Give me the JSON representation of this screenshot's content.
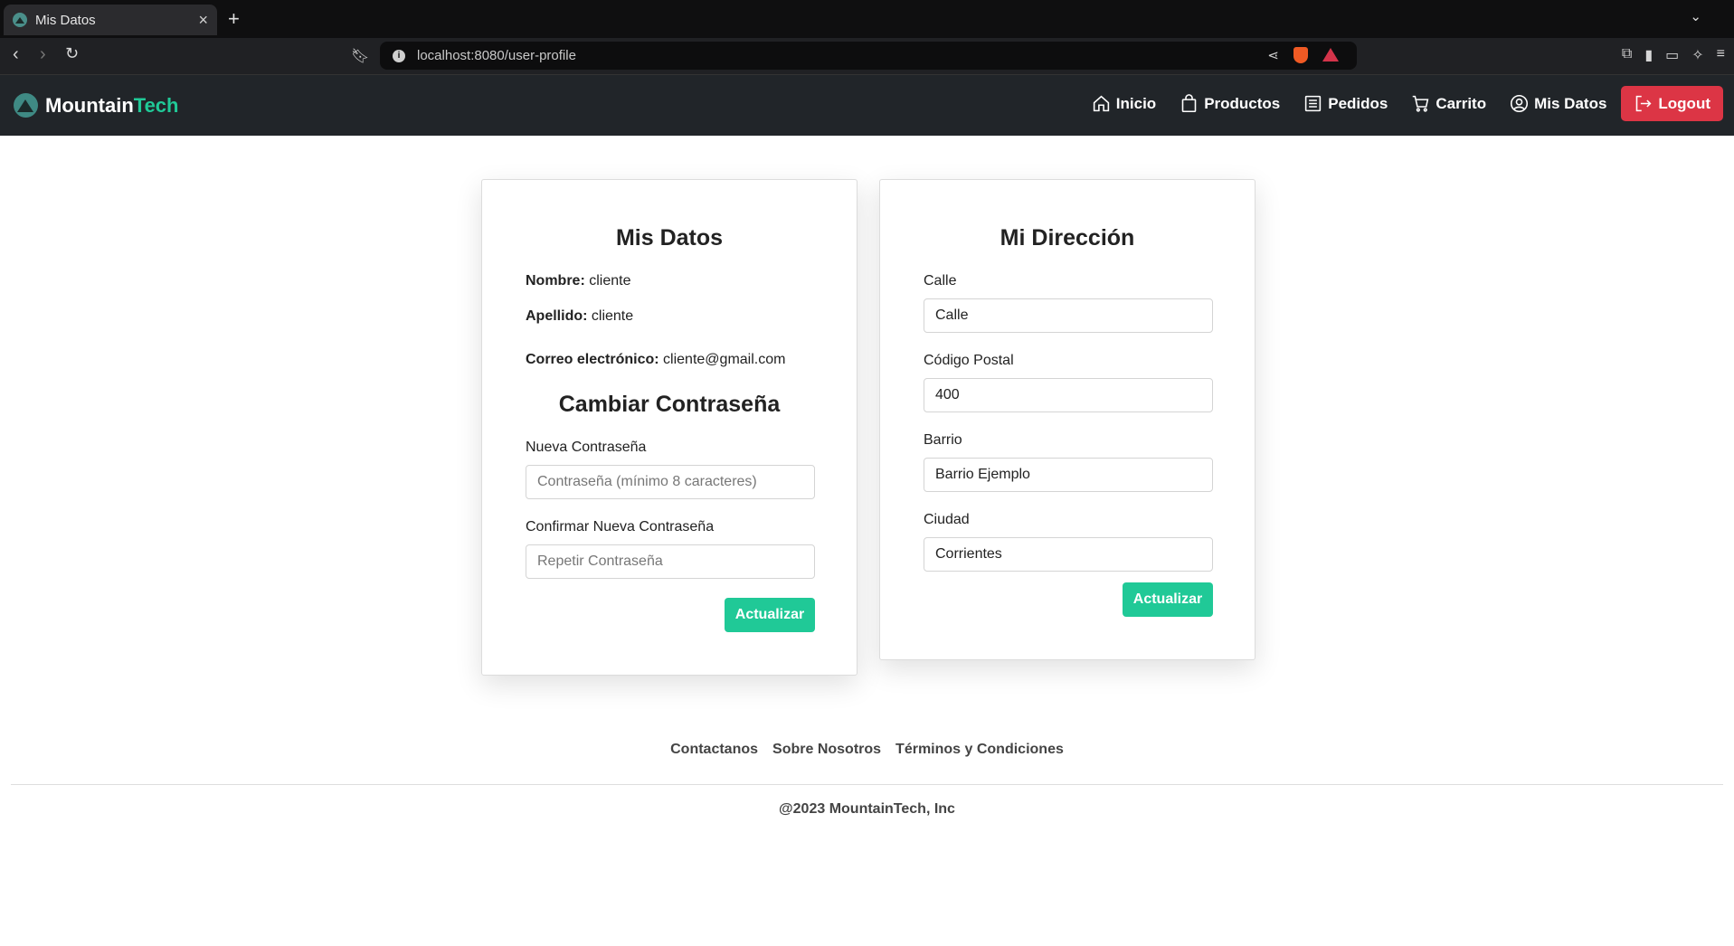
{
  "browser": {
    "tab_title": "Mis Datos",
    "url": "localhost:8080/user-profile"
  },
  "brand": {
    "part1": "Mountain",
    "part2": "Tech",
    "accent_color": "#20c997"
  },
  "nav": {
    "items": [
      {
        "label": "Inicio",
        "icon": "home-icon"
      },
      {
        "label": "Productos",
        "icon": "bag-icon"
      },
      {
        "label": "Pedidos",
        "icon": "list-icon"
      },
      {
        "label": "Carrito",
        "icon": "cart-icon"
      },
      {
        "label": "Mis Datos",
        "icon": "user-circle-icon"
      }
    ],
    "logout": {
      "label": "Logout",
      "icon": "logout-icon",
      "color": "#dc3545"
    }
  },
  "profile": {
    "title": "Mis Datos",
    "name_label": "Nombre:",
    "name_value": "cliente",
    "lastname_label": "Apellido:",
    "lastname_value": "cliente",
    "email_label": "Correo electrónico:",
    "email_value": "cliente@gmail.com"
  },
  "password": {
    "title": "Cambiar Contraseña",
    "new_label": "Nueva Contraseña",
    "new_placeholder": "Contraseña (mínimo 8 caracteres)",
    "confirm_label": "Confirmar Nueva Contraseña",
    "confirm_placeholder": "Repetir Contraseña",
    "button": "Actualizar"
  },
  "address": {
    "title": "Mi Dirección",
    "street_label": "Calle",
    "street_value": "Calle",
    "zip_label": "Código Postal",
    "zip_value": "400",
    "district_label": "Barrio",
    "district_value": "Barrio Ejemplo",
    "city_label": "Ciudad",
    "city_value": "Corrientes",
    "button": "Actualizar"
  },
  "footer": {
    "links": [
      "Contactanos",
      "Sobre Nosotros",
      "Términos y Condiciones"
    ],
    "copyright": "@2023 MountainTech, Inc"
  }
}
